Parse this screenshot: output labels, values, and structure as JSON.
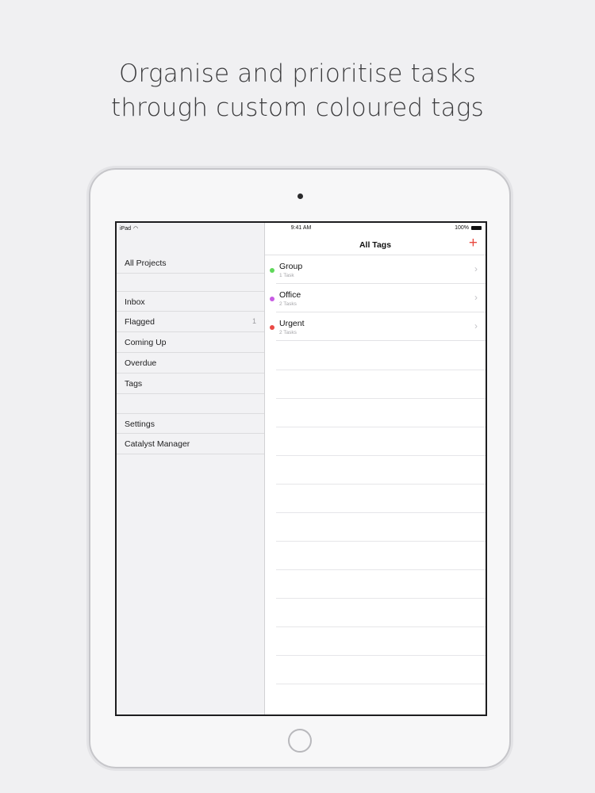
{
  "headline": {
    "line1": "Organise and prioritise tasks",
    "line2": "through custom coloured tags"
  },
  "status_bar": {
    "device": "iPad",
    "wifi_icon": "wifi-icon",
    "time": "9:41 AM",
    "battery": "100%"
  },
  "sidebar": {
    "items": [
      {
        "label": "All Projects",
        "count": ""
      },
      {
        "label": "Inbox",
        "count": ""
      },
      {
        "label": "Flagged",
        "count": "1"
      },
      {
        "label": "Coming Up",
        "count": ""
      },
      {
        "label": "Overdue",
        "count": ""
      },
      {
        "label": "Tags",
        "count": ""
      },
      {
        "label": "Settings",
        "count": ""
      },
      {
        "label": "Catalyst Manager",
        "count": ""
      }
    ]
  },
  "main": {
    "title": "All Tags",
    "add_icon": "plus-icon",
    "accent_color": "#e9493f",
    "tags": [
      {
        "name": "Group",
        "subtitle": "1 Task",
        "color": "#5fd85a"
      },
      {
        "name": "Office",
        "subtitle": "2 Tasks",
        "color": "#c75be3"
      },
      {
        "name": "Urgent",
        "subtitle": "2 Tasks",
        "color": "#ea4a45"
      }
    ]
  }
}
